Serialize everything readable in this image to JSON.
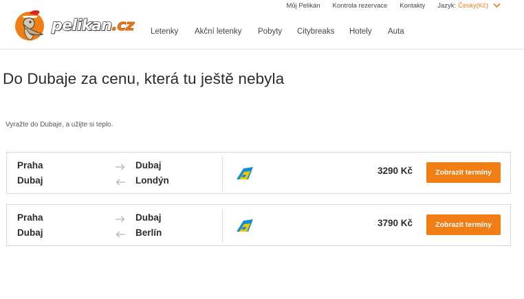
{
  "brand": {
    "name_white": "pelikan",
    "name_orange": ".cz",
    "color_orange": "#f17e15"
  },
  "toplinks": {
    "my_pelikan": "Můj Pelikán",
    "check_booking": "Kontrola rezervace",
    "contacts": "Kontakty",
    "language_label": "Jazyk:",
    "language_value": "Česky(Kč)"
  },
  "nav": [
    "Letenky",
    "Akční letenky",
    "Pobyty",
    "Citybreaks",
    "Hotely",
    "Auta"
  ],
  "page": {
    "title": "Do Dubaje za cenu, která tu ještě nebyla",
    "subtitle": "Vyražte do Dubaje, a užijte si teplo."
  },
  "offers": [
    {
      "out_from": "Praha",
      "out_to": "Dubaj",
      "ret_from": "Dubaj",
      "ret_to": "Londýn",
      "airline_icon": "airline-tail-logo",
      "price": "3290 Kč",
      "button": "Zobrazit termíny"
    },
    {
      "out_from": "Praha",
      "out_to": "Dubaj",
      "ret_from": "Dubaj",
      "ret_to": "Berlín",
      "airline_icon": "airline-tail-logo",
      "price": "3790 Kč",
      "button": "Zobrazit termíny"
    }
  ]
}
